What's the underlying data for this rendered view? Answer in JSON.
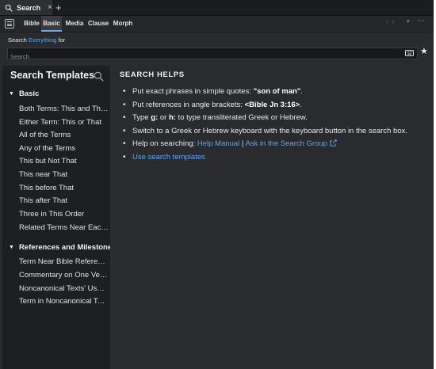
{
  "tab": {
    "label": "Search",
    "close": "×",
    "new": "+"
  },
  "modes": [
    "Bible",
    "Basic",
    "Media",
    "Clause",
    "Morph"
  ],
  "active_mode": "Basic",
  "nav": {
    "back": "‹",
    "forward": "›",
    "dropdown": "▾",
    "more": "⋯"
  },
  "search": {
    "for_prefix": "Search ",
    "scope": "Everything",
    "for_suffix": " for",
    "placeholder": "Search",
    "value": ""
  },
  "templates": {
    "title": "Search Templates",
    "groups": [
      {
        "name": "Basic",
        "items": [
          "Both Terms: This and Th…",
          "Either Term: This or That",
          "All of the Terms",
          "Any of the Terms",
          "This but Not That",
          "This near That",
          "This before That",
          "This after That",
          "Three in This Order",
          "Related Terms Near Each…"
        ]
      },
      {
        "name": "References and Milestones",
        "items": [
          "Term Near Bible Reference",
          "Commentary on One Verse",
          "Noncanonical Texts' Use…",
          "Term in Noncanonical Texts"
        ]
      }
    ]
  },
  "helps": {
    "title": "SEARCH HELPS",
    "quotes": {
      "pre": "Put exact phrases in simple quotes: ",
      "strong": "\"son of man\"",
      "post": "."
    },
    "refs": {
      "pre": "Put references in angle brackets: ",
      "strong": "<Bible Jn 3:16>",
      "post": "."
    },
    "translit": {
      "pre": "Type ",
      "strong1": "g:",
      "mid": " or ",
      "strong2": "h:",
      "post": " to type transliterated Greek or Hebrew."
    },
    "keyboard": "Switch to a Greek or Hebrew keyboard with the keyboard button in the search box.",
    "help": {
      "pre": "Help on searching: ",
      "link1": "Help Manual",
      "sep": " | ",
      "link2": "Ask in the Search Group"
    },
    "use_templates": "Use search templates"
  },
  "icons": [
    "search-icon",
    "close-icon",
    "menu-icon",
    "keyboard-icon",
    "star-icon",
    "external-link-icon",
    "caret-down-icon"
  ],
  "colors": {
    "accent": "#5aa7f0",
    "background": "#2a2b2f",
    "panel": "#1e1f22"
  }
}
